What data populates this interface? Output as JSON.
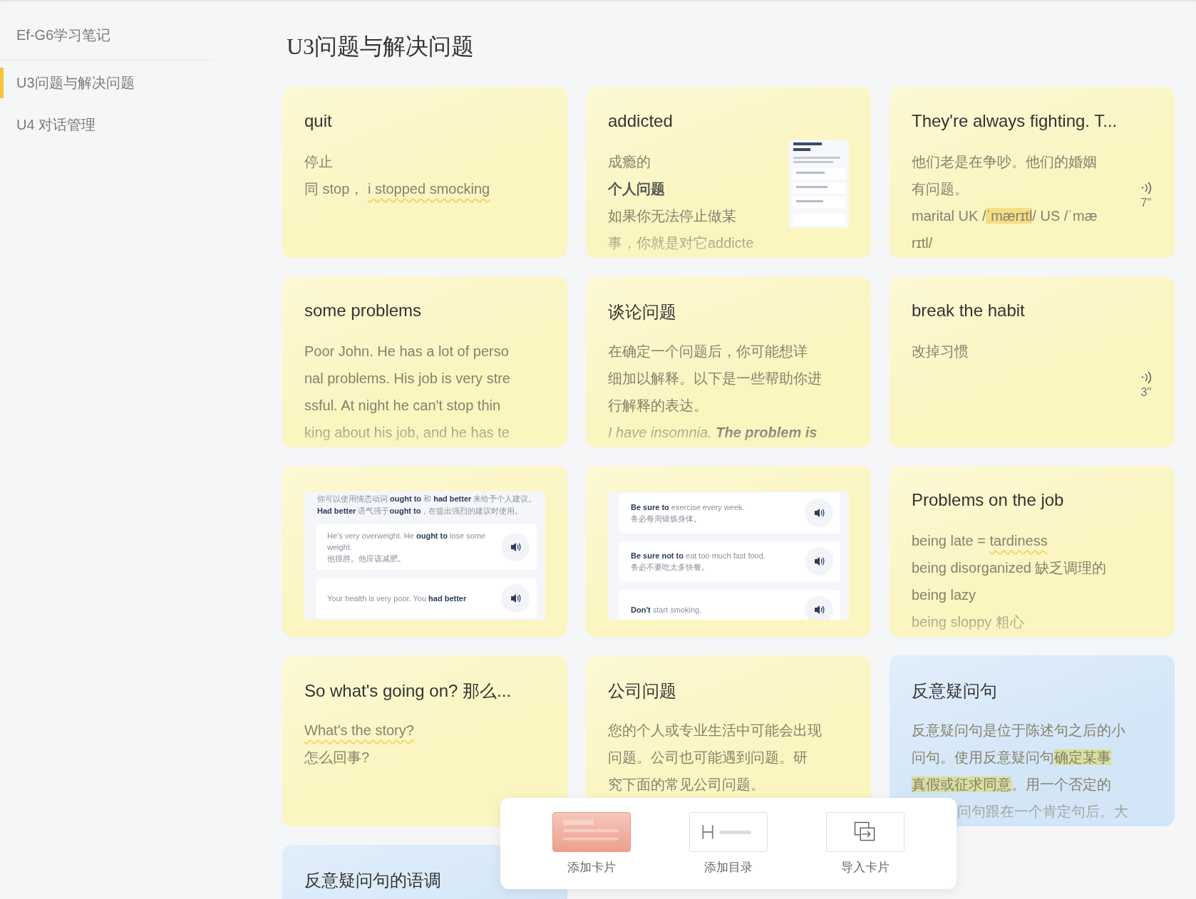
{
  "sidebar": {
    "notebook": "Ef-G6学习笔记",
    "items": [
      {
        "label": "U3问题与解决问题",
        "selected": true
      },
      {
        "label": "U4 对话管理",
        "selected": false
      }
    ]
  },
  "page_title": "U3问题与解决问题",
  "cards": [
    {
      "kind": "text",
      "color": "#fbf5c0",
      "title": "quit",
      "lines": [
        [
          {
            "text": "停止"
          }
        ],
        [
          {
            "text": "同 stop，  "
          },
          {
            "text": "i stopped smocking",
            "wavy": true
          }
        ]
      ]
    },
    {
      "kind": "text",
      "color": "#fbf5c0",
      "title": "addicted",
      "truncated": true,
      "thumbnail": true,
      "lines": [
        [
          {
            "text": "成瘾的"
          }
        ],
        [
          {
            "text": "**个人问题**"
          }
        ],
        [
          {
            "text": "如果你无法停止做某"
          }
        ],
        [
          {
            "text": "事，你就是对它addicte"
          }
        ]
      ]
    },
    {
      "kind": "text",
      "color": "#fbf5c0",
      "title": "They're always fighting. T...",
      "audio": "7''",
      "lines": [
        [
          {
            "text": "他们老是在争吵。他们的婚姻"
          }
        ],
        [
          {
            "text": "有问题。"
          }
        ],
        [
          {
            "text": "marital UK /"
          },
          {
            "text": "ˈmærɪtl",
            "highlight": true
          },
          {
            "text": "/ US /ˈmæ"
          }
        ],
        [
          {
            "text": "rɪtl/"
          }
        ]
      ]
    },
    {
      "kind": "text",
      "color": "#fbf5c0",
      "title": "some problems",
      "truncated": true,
      "lines": [
        [
          {
            "text": "Poor John. He has a lot of perso"
          }
        ],
        [
          {
            "text": "nal problems. His job is very stre"
          }
        ],
        [
          {
            "text": "ssful. At night he can't stop thin"
          }
        ],
        [
          {
            "text": "king about his job, and he has te"
          }
        ]
      ]
    },
    {
      "kind": "text",
      "color": "#fbf5c0",
      "title": "谈论问题",
      "truncated": true,
      "lines": [
        [
          {
            "text": "在确定一个问题后，你可能想详"
          }
        ],
        [
          {
            "text": "细加以解释。以下是一些帮助你进"
          }
        ],
        [
          {
            "text": "行解释的表达。"
          }
        ],
        [
          {
            "text": "I have insomnia. **The problem is**",
            "italic": true
          }
        ]
      ]
    },
    {
      "kind": "text",
      "color": "#fbf5c0",
      "title": "break the habit",
      "audio": "3''",
      "lines": [
        [
          {
            "text": "改掉习惯"
          }
        ]
      ]
    },
    {
      "kind": "lesson",
      "color": "#fbf5c0",
      "intro": "你可以使用情态动词 **ought to** 和 **had better** 来给予个人建议。**Had better** 语气强于**ought to**，在提出强烈的建议时使用。",
      "examples": [
        {
          "en": "He's very overweight. He **ought to** lose some weight.",
          "zh": "他很胖。他应该减肥。"
        },
        {
          "en": "Your health is very poor. You **had better**"
        }
      ]
    },
    {
      "kind": "lesson",
      "color": "#fbf5c0",
      "examples": [
        {
          "en": "**Be sure to** exercise every week.",
          "zh": "务必每周锻炼身体。"
        },
        {
          "en": "**Be sure not to** eat too much fast food.",
          "zh": "务必不要吃太多快餐。"
        },
        {
          "en": "**Don't** start smoking."
        }
      ]
    },
    {
      "kind": "text",
      "color": "#fbf5c0",
      "title": "Problems on the job",
      "truncated": true,
      "lines": [
        [
          {
            "text": "being late = "
          },
          {
            "text": "tardiness",
            "wavy": true
          }
        ],
        [
          {
            "text": "being disorganized 缺乏调理的"
          }
        ],
        [
          {
            "text": "being lazy"
          }
        ],
        [
          {
            "text": "being sloppy 粗心"
          }
        ]
      ]
    },
    {
      "kind": "text",
      "color": "#fbf5c0",
      "title": "So what's going on? 那么...",
      "lines": [
        [
          {
            "text": "What's the story?",
            "wavy": true
          }
        ],
        [
          {
            "text": "怎么回事?"
          }
        ]
      ]
    },
    {
      "kind": "text",
      "color": "#fbf5c0",
      "title": "公司问题",
      "lines": [
        [
          {
            "text": "您的个人或专业生活中可能会出现"
          }
        ],
        [
          {
            "text": "问题。公司也可能遇到问题。研"
          }
        ],
        [
          {
            "text": "究下面的常见公司问题。"
          }
        ]
      ]
    },
    {
      "kind": "text",
      "color": "#d3e6f8",
      "title": "反意疑问句",
      "truncated": true,
      "lines": [
        [
          {
            "text": "反意疑问句是位于陈述句之后的小"
          }
        ],
        [
          {
            "text": "问句。使用反意疑问句"
          },
          {
            "text": "确定某事",
            "highlight": true
          }
        ],
        [
          {
            "text": "真假或征求同意",
            "highlight": true
          },
          {
            "text": "。用一个否定的"
          }
        ],
        [
          {
            "text": "问句跟在一个肯定句后。大",
            "covered_start": true
          }
        ]
      ]
    },
    {
      "kind": "text",
      "color": "#d3e6f8",
      "title": "反意疑问句的语调"
    }
  ],
  "toolbar": [
    {
      "kind": "card",
      "label": "添加卡片",
      "selected": true
    },
    {
      "kind": "heading",
      "label": "添加目录",
      "selected": false
    },
    {
      "kind": "import",
      "label": "导入卡片",
      "selected": false
    }
  ]
}
